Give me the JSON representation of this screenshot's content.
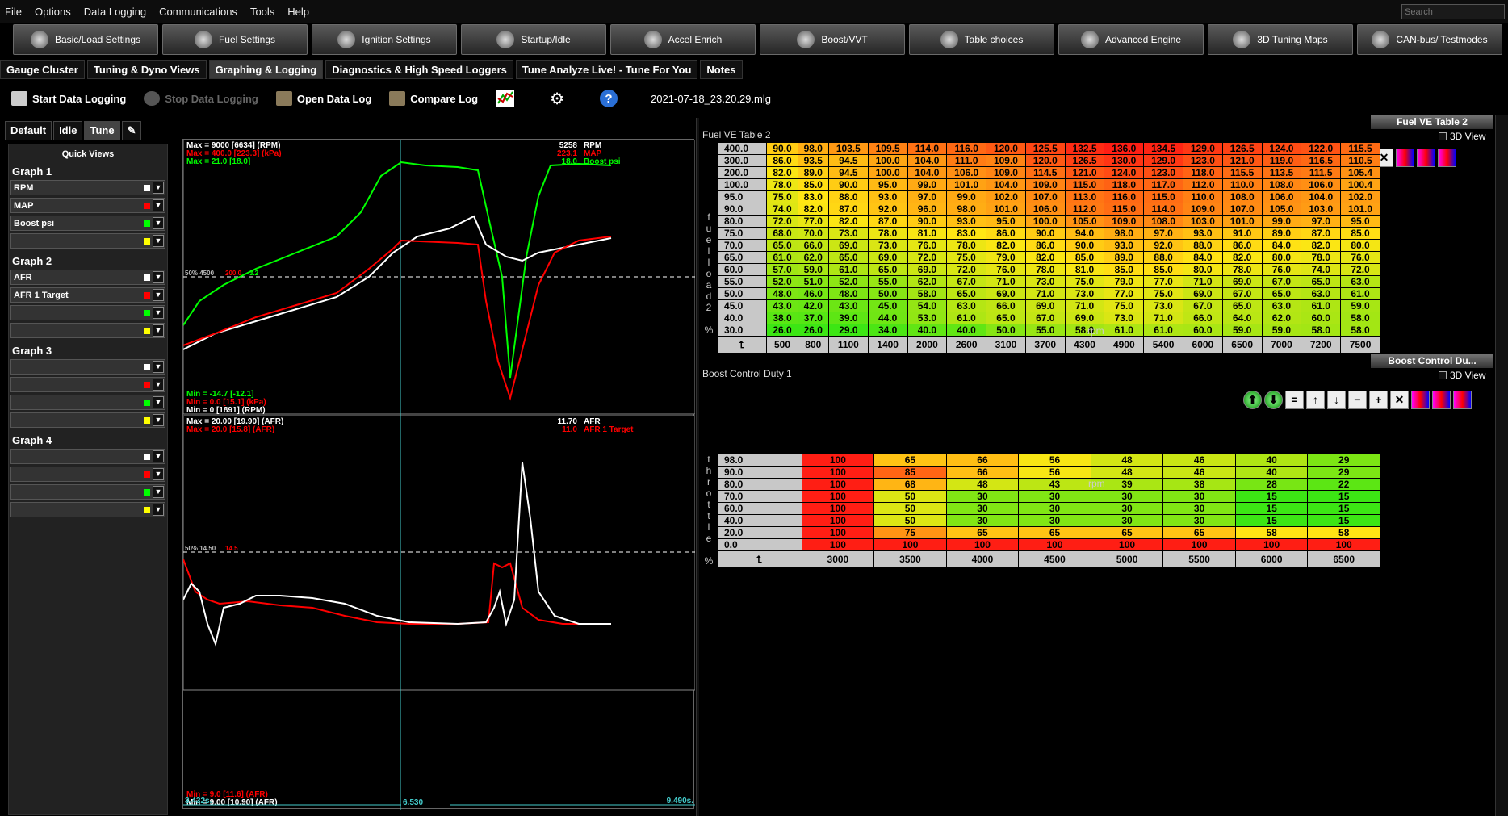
{
  "menu": [
    "File",
    "Options",
    "Data Logging",
    "Communications",
    "Tools",
    "Help"
  ],
  "search_placeholder": "Search",
  "toolbar": [
    {
      "label": "Basic/Load Settings",
      "icon": "gear-icon"
    },
    {
      "label": "Fuel Settings",
      "icon": "injector-icon"
    },
    {
      "label": "Ignition Settings",
      "icon": "spark-plug-icon"
    },
    {
      "label": "Startup/Idle",
      "icon": "idle-icon"
    },
    {
      "label": "Accel Enrich",
      "icon": "accel-icon"
    },
    {
      "label": "Boost/VVT",
      "icon": "turbo-icon"
    },
    {
      "label": "Table choices",
      "icon": "table-icon"
    },
    {
      "label": "Advanced Engine",
      "icon": "gears-icon"
    },
    {
      "label": "3D Tuning Maps",
      "icon": "wrench-icon"
    },
    {
      "label": "CAN-bus/ Testmodes",
      "icon": "network-icon"
    }
  ],
  "tabs": [
    "Gauge Cluster",
    "Tuning & Dyno Views",
    "Graphing & Logging",
    "Diagnostics & High Speed Loggers",
    "Tune Analyze Live! - Tune For You",
    "Notes"
  ],
  "active_tab": "Graphing & Logging",
  "actions": {
    "start": "Start Data Logging",
    "stop": "Stop Data Logging",
    "open": "Open Data Log",
    "compare": "Compare Log",
    "filename": "2021-07-18_23.20.29.mlg"
  },
  "subtabs": [
    "Default",
    "Idle",
    "Tune"
  ],
  "quickviews": {
    "title": "Quick Views",
    "graphs": [
      {
        "name": "Graph 1",
        "rows": [
          {
            "label": "RPM",
            "color": "#ffffff"
          },
          {
            "label": "MAP",
            "color": "#ff0000"
          },
          {
            "label": "Boost psi",
            "color": "#00ff00"
          },
          {
            "label": "",
            "color": "#ffff00"
          }
        ]
      },
      {
        "name": "Graph 2",
        "rows": [
          {
            "label": "AFR",
            "color": "#ffffff"
          },
          {
            "label": "AFR 1 Target",
            "color": "#ff0000"
          },
          {
            "label": "",
            "color": "#00ff00"
          },
          {
            "label": "",
            "color": "#ffff00"
          }
        ]
      },
      {
        "name": "Graph 3",
        "rows": [
          {
            "label": "",
            "color": "#ffffff"
          },
          {
            "label": "",
            "color": "#ff0000"
          },
          {
            "label": "",
            "color": "#00ff00"
          },
          {
            "label": "",
            "color": "#ffff00"
          }
        ]
      },
      {
        "name": "Graph 4",
        "rows": [
          {
            "label": "",
            "color": "#ffffff"
          },
          {
            "label": "",
            "color": "#ff0000"
          },
          {
            "label": "",
            "color": "#00ff00"
          },
          {
            "label": "",
            "color": "#ffff00"
          }
        ]
      }
    ]
  },
  "graph1": {
    "max_lines": [
      {
        "text": "Max = 9000 [6634] (RPM)",
        "color": "#ffffff"
      },
      {
        "text": "Max = 400.0 [223.3] (kPa)",
        "color": "#ff0000"
      },
      {
        "text": "Max = 21.0 [18.0]",
        "color": "#00ff00"
      }
    ],
    "cursor_values": [
      {
        "value": "5258",
        "name": "RPM",
        "color": "#ffffff"
      },
      {
        "value": "223.1",
        "name": "MAP",
        "color": "#ff0000"
      },
      {
        "value": "18.0",
        "name": "Boost psi",
        "color": "#00ff00"
      }
    ],
    "min_lines": [
      {
        "text": "Min = -14.7 [-12.1]",
        "color": "#00ff00"
      },
      {
        "text": "Min = 0.0 [15.1] (kPa)",
        "color": "#ff0000"
      },
      {
        "text": "Min = 0 [1891] (RPM)",
        "color": "#ffffff"
      }
    ],
    "mid_label": "50%   4500",
    "mid_label_red": "200.0",
    "mid_label_green": "3.2"
  },
  "graph2": {
    "max_lines": [
      {
        "text": "Max = 20.00 [19.90] (AFR)",
        "color": "#ffffff"
      },
      {
        "text": "Max = 20.0 [15.8] (AFR)",
        "color": "#ff0000"
      }
    ],
    "cursor_values": [
      {
        "value": "11.70",
        "name": "AFR",
        "color": "#ffffff"
      },
      {
        "value": "11.0",
        "name": "AFR 1 Target",
        "color": "#ff0000"
      }
    ],
    "min_lines": [
      {
        "text": "Min = 9.0 [11.6] (AFR)",
        "color": "#ff0000"
      },
      {
        "text": "Min = 9.00 [10.90] (AFR)",
        "color": "#ffffff"
      }
    ],
    "mid_label": "50%   14.50",
    "mid_label_red": "14.5"
  },
  "timeline": {
    "start": "3.432s.",
    "cursor": "6.530",
    "end": "9.490s."
  },
  "ve_table": {
    "title": "Fuel VE Table 2",
    "badge": "Fuel VE Table 2",
    "view3d": "3D View",
    "y_axis_label": "fuelload2 %",
    "x_axis_label": "rpm",
    "rows": [
      "400.0",
      "300.0",
      "200.0",
      "100.0",
      "95.0",
      "90.0",
      "80.0",
      "75.0",
      "70.0",
      "65.0",
      "60.0",
      "55.0",
      "50.0",
      "45.0",
      "40.0",
      "30.0"
    ],
    "cols": [
      "500",
      "800",
      "1100",
      "1400",
      "2000",
      "2600",
      "3100",
      "3700",
      "4300",
      "4900",
      "5400",
      "6000",
      "6500",
      "7000",
      "7200",
      "7500"
    ],
    "values": [
      [
        "90.0",
        "98.0",
        "103.5",
        "109.5",
        "114.0",
        "116.0",
        "120.0",
        "125.5",
        "132.5",
        "136.0",
        "134.5",
        "129.0",
        "126.5",
        "124.0",
        "122.0",
        "115.5"
      ],
      [
        "86.0",
        "93.5",
        "94.5",
        "100.0",
        "104.0",
        "111.0",
        "109.0",
        "120.0",
        "126.5",
        "130.0",
        "129.0",
        "123.0",
        "121.0",
        "119.0",
        "116.5",
        "110.5"
      ],
      [
        "82.0",
        "89.0",
        "94.5",
        "100.0",
        "104.0",
        "106.0",
        "109.0",
        "114.5",
        "121.0",
        "124.0",
        "123.0",
        "118.0",
        "115.5",
        "113.5",
        "111.5",
        "105.4"
      ],
      [
        "78.0",
        "85.0",
        "90.0",
        "95.0",
        "99.0",
        "101.0",
        "104.0",
        "109.0",
        "115.0",
        "118.0",
        "117.0",
        "112.0",
        "110.0",
        "108.0",
        "106.0",
        "100.4"
      ],
      [
        "75.0",
        "83.0",
        "88.0",
        "93.0",
        "97.0",
        "99.0",
        "102.0",
        "107.0",
        "113.0",
        "116.0",
        "115.0",
        "110.0",
        "108.0",
        "106.0",
        "104.0",
        "102.0"
      ],
      [
        "74.0",
        "82.0",
        "87.0",
        "92.0",
        "96.0",
        "98.0",
        "101.0",
        "106.0",
        "112.0",
        "115.0",
        "114.0",
        "109.0",
        "107.0",
        "105.0",
        "103.0",
        "101.0"
      ],
      [
        "72.0",
        "77.0",
        "82.0",
        "87.0",
        "90.0",
        "93.0",
        "95.0",
        "100.0",
        "105.0",
        "109.0",
        "108.0",
        "103.0",
        "101.0",
        "99.0",
        "97.0",
        "95.0"
      ],
      [
        "68.0",
        "70.0",
        "73.0",
        "78.0",
        "81.0",
        "83.0",
        "86.0",
        "90.0",
        "94.0",
        "98.0",
        "97.0",
        "93.0",
        "91.0",
        "89.0",
        "87.0",
        "85.0"
      ],
      [
        "65.0",
        "66.0",
        "69.0",
        "73.0",
        "76.0",
        "78.0",
        "82.0",
        "86.0",
        "90.0",
        "93.0",
        "92.0",
        "88.0",
        "86.0",
        "84.0",
        "82.0",
        "80.0"
      ],
      [
        "61.0",
        "62.0",
        "65.0",
        "69.0",
        "72.0",
        "75.0",
        "79.0",
        "82.0",
        "85.0",
        "89.0",
        "88.0",
        "84.0",
        "82.0",
        "80.0",
        "78.0",
        "76.0"
      ],
      [
        "57.0",
        "59.0",
        "61.0",
        "65.0",
        "69.0",
        "72.0",
        "76.0",
        "78.0",
        "81.0",
        "85.0",
        "85.0",
        "80.0",
        "78.0",
        "76.0",
        "74.0",
        "72.0"
      ],
      [
        "52.0",
        "51.0",
        "52.0",
        "55.0",
        "62.0",
        "67.0",
        "71.0",
        "73.0",
        "75.0",
        "79.0",
        "77.0",
        "71.0",
        "69.0",
        "67.0",
        "65.0",
        "63.0"
      ],
      [
        "48.0",
        "46.0",
        "48.0",
        "50.0",
        "58.0",
        "65.0",
        "69.0",
        "71.0",
        "73.0",
        "77.0",
        "75.0",
        "69.0",
        "67.0",
        "65.0",
        "63.0",
        "61.0"
      ],
      [
        "43.0",
        "42.0",
        "43.0",
        "45.0",
        "54.0",
        "63.0",
        "66.0",
        "69.0",
        "71.0",
        "75.0",
        "73.0",
        "67.0",
        "65.0",
        "63.0",
        "61.0",
        "59.0"
      ],
      [
        "38.0",
        "37.0",
        "39.0",
        "44.0",
        "53.0",
        "61.0",
        "65.0",
        "67.0",
        "69.0",
        "73.0",
        "71.0",
        "66.0",
        "64.0",
        "62.0",
        "60.0",
        "58.0"
      ],
      [
        "26.0",
        "26.0",
        "29.0",
        "34.0",
        "40.0",
        "40.0",
        "50.0",
        "55.0",
        "58.0",
        "61.0",
        "61.0",
        "60.0",
        "59.0",
        "59.0",
        "58.0",
        "58.0"
      ]
    ]
  },
  "boost_table": {
    "title": "Boost Control Duty 1",
    "badge": "Boost Control Du...",
    "view3d": "3D View",
    "y_axis_label": "throttle %",
    "x_axis_label": "rpm",
    "rows": [
      "98.0",
      "90.0",
      "80.0",
      "70.0",
      "60.0",
      "40.0",
      "20.0",
      "0.0"
    ],
    "cols": [
      "3000",
      "3500",
      "4000",
      "4500",
      "5000",
      "5500",
      "6000",
      "6500"
    ],
    "values": [
      [
        "100",
        "65",
        "66",
        "56",
        "48",
        "46",
        "40",
        "29"
      ],
      [
        "100",
        "85",
        "66",
        "56",
        "48",
        "46",
        "40",
        "29"
      ],
      [
        "100",
        "68",
        "48",
        "43",
        "39",
        "38",
        "28",
        "22"
      ],
      [
        "100",
        "50",
        "30",
        "30",
        "30",
        "30",
        "15",
        "15"
      ],
      [
        "100",
        "50",
        "30",
        "30",
        "30",
        "30",
        "15",
        "15"
      ],
      [
        "100",
        "50",
        "30",
        "30",
        "30",
        "30",
        "15",
        "15"
      ],
      [
        "100",
        "75",
        "65",
        "65",
        "65",
        "65",
        "58",
        "58"
      ],
      [
        "100",
        "100",
        "100",
        "100",
        "100",
        "100",
        "100",
        "100"
      ]
    ]
  }
}
